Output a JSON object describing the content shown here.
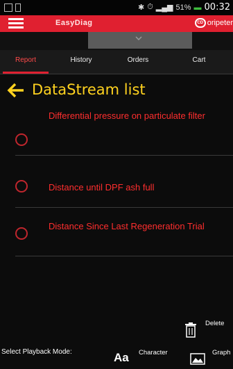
{
  "status_bar": {
    "battery": "51%",
    "time": "00:32"
  },
  "header": {
    "title": "EasyDiag",
    "logo_text": "oripeter"
  },
  "tabs": [
    {
      "label": "Report",
      "active": true
    },
    {
      "label": "History",
      "active": false
    },
    {
      "label": "Orders",
      "active": false
    },
    {
      "label": "Cart",
      "active": false
    }
  ],
  "page": {
    "title": "DataStream list"
  },
  "datastream_items": [
    {
      "label": "Differential pressure on particulate filter"
    },
    {
      "label": "Distance until DPF ash full"
    },
    {
      "label": "Distance Since Last Regeneration Trial"
    }
  ],
  "footer": {
    "delete_label": "Delete",
    "playback_label": "Select Playback Mode:",
    "character_icon": "Aa",
    "character_label": "Character",
    "graph_label": "Graph"
  },
  "colors": {
    "accent": "#e02030",
    "title": "#ffd21f",
    "item_text": "#ff2e2e",
    "background": "#0c0c0c"
  }
}
